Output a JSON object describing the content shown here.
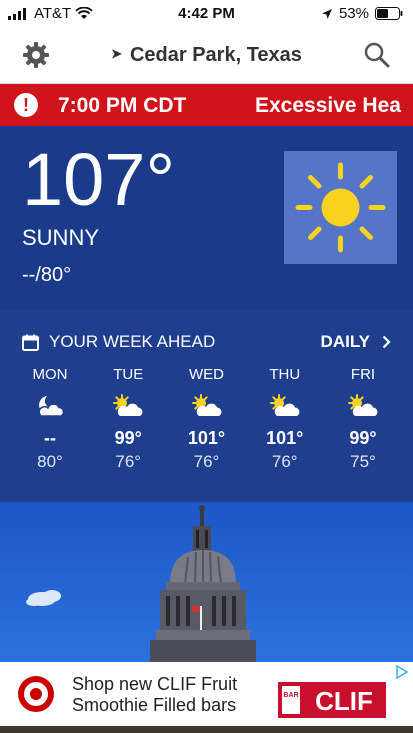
{
  "status_bar": {
    "carrier": "AT&T",
    "time": "4:42 PM",
    "battery": "53%"
  },
  "nav": {
    "location": "Cedar Park, Texas"
  },
  "alert": {
    "time": "7:00 PM CDT",
    "message": "Excessive Hea"
  },
  "current": {
    "temperature": "107°",
    "condition": "SUNNY",
    "hi_lo": "--/80°",
    "icon": "sun-icon"
  },
  "week": {
    "title": "YOUR WEEK AHEAD",
    "daily_label": "DAILY",
    "days": [
      {
        "name": "MON",
        "hi": "--",
        "lo": "80°",
        "icon": "moon-cloud-icon"
      },
      {
        "name": "TUE",
        "hi": "99°",
        "lo": "76°",
        "icon": "partly-sunny-icon"
      },
      {
        "name": "WED",
        "hi": "101°",
        "lo": "76°",
        "icon": "partly-sunny-icon"
      },
      {
        "name": "THU",
        "hi": "101°",
        "lo": "76°",
        "icon": "partly-sunny-icon"
      },
      {
        "name": "FRI",
        "hi": "99°",
        "lo": "75°",
        "icon": "partly-sunny-icon"
      }
    ]
  },
  "ad": {
    "line1": "Shop new CLIF Fruit",
    "line2": "Smoothie Filled bars",
    "brand": "CLIF",
    "brand_small": "BAR"
  },
  "colors": {
    "alert_red": "#d0121b",
    "panel_blue": "#1a3a8a",
    "sun_yellow": "#f7d21e",
    "icon_box": "#5575c8"
  }
}
